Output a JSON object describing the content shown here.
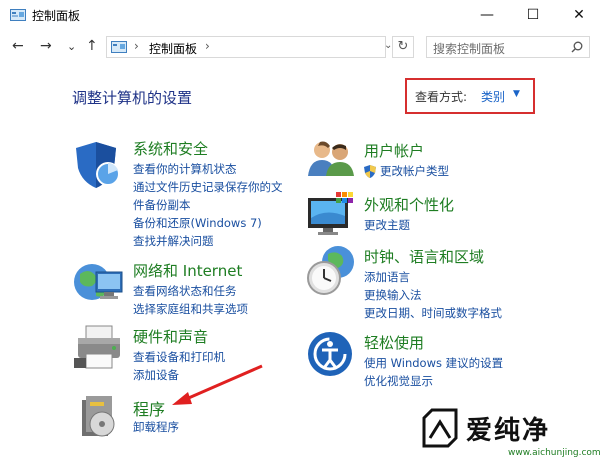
{
  "window": {
    "title": "控制面板",
    "minimize": "—",
    "maximize": "☐",
    "close": "✕"
  },
  "nav": {
    "back": "←",
    "forward": "→",
    "history": "⌄",
    "up": "↑",
    "address_sep": "›",
    "address_text": "控制面板",
    "refresh": "↻",
    "search_placeholder": "搜索控制面板"
  },
  "main": {
    "heading": "调整计算机的设置",
    "view_label": "查看方式:",
    "view_value": "类别",
    "view_caret": "▼"
  },
  "categories": [
    {
      "title": "系统和安全",
      "icon": "shield-icon",
      "links": [
        "查看你的计算机状态",
        "通过文件历史记录保存你的文",
        "件备份副本",
        "备份和还原(Windows 7)",
        "查找并解决问题"
      ]
    },
    {
      "title": "网络和 Internet",
      "icon": "network-globe-icon",
      "links": [
        "查看网络状态和任务",
        "选择家庭组和共享选项"
      ]
    },
    {
      "title": "硬件和声音",
      "icon": "printer-icon",
      "links": [
        "查看设备和打印机",
        "添加设备"
      ]
    },
    {
      "title": "程序",
      "icon": "programs-icon",
      "links": [
        "卸载程序"
      ]
    },
    {
      "title": "用户帐户",
      "icon": "users-icon",
      "links": [
        "更改帐户类型"
      ]
    },
    {
      "title": "外观和个性化",
      "icon": "monitor-icon",
      "links": [
        "更改主题"
      ]
    },
    {
      "title": "时钟、语言和区域",
      "icon": "clock-globe-icon",
      "links": [
        "添加语言",
        "更换输入法",
        "更改日期、时间或数字格式"
      ]
    },
    {
      "title": "轻松使用",
      "icon": "ease-of-access-icon",
      "links": [
        "使用 Windows 建议的设置",
        "优化视觉显示"
      ]
    }
  ],
  "watermark": {
    "name": "爱纯净",
    "url": "www.aichunjing.com"
  },
  "colors": {
    "category_green": "#1e7d22",
    "link_blue": "#1a4fa0",
    "heading_blue": "#1e3287",
    "highlight_red": "#d62f2f"
  }
}
